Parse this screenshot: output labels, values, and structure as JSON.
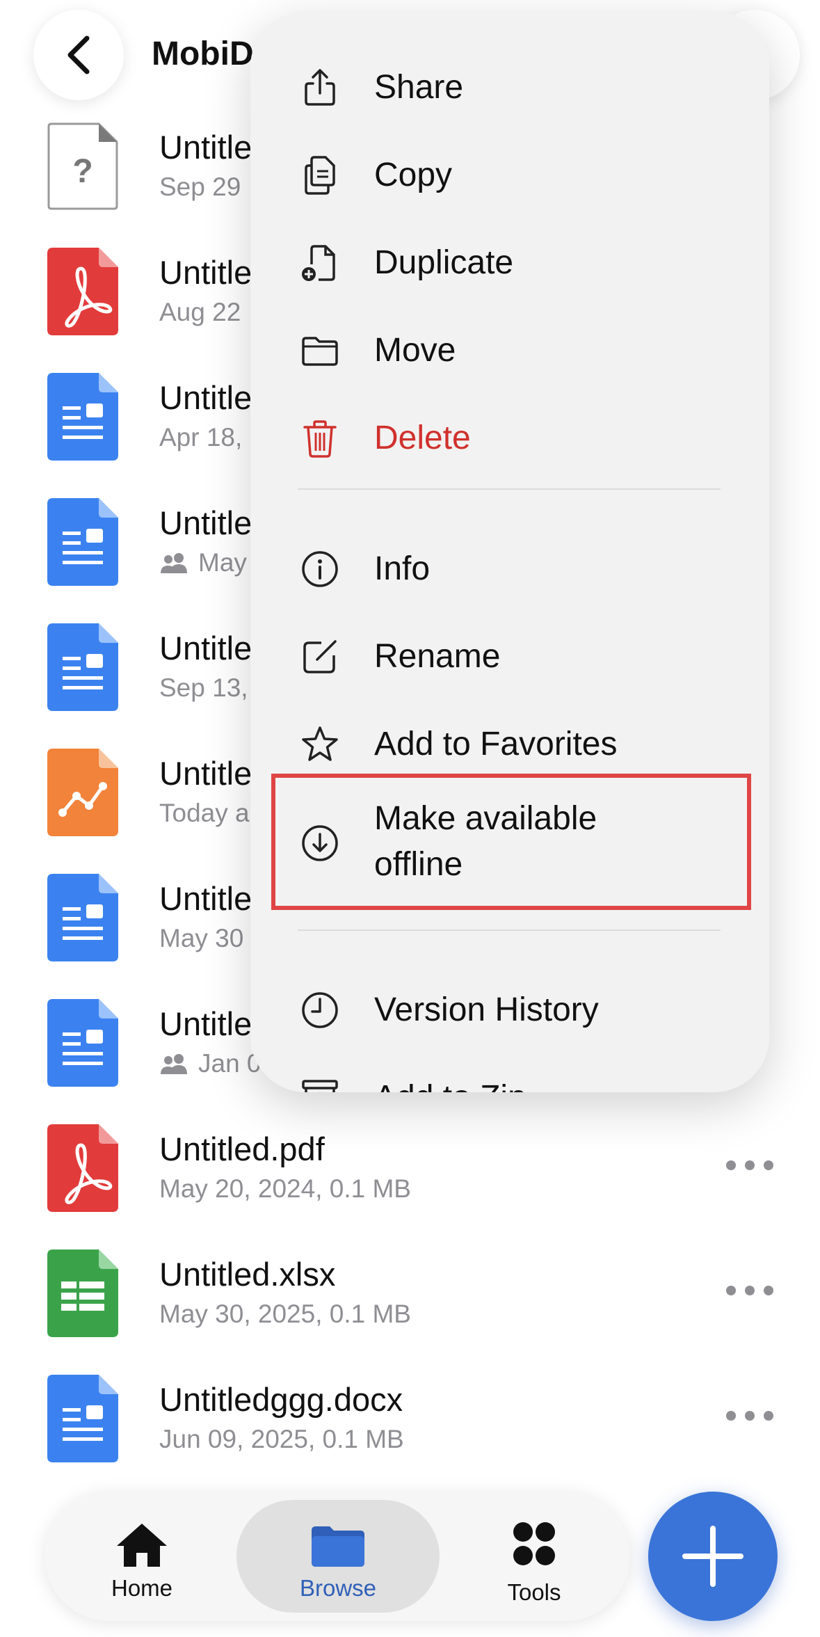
{
  "header": {
    "title": "MobiD"
  },
  "files": [
    {
      "name": "Untitle",
      "meta": "Sep 29",
      "type": "unknown",
      "shared": false
    },
    {
      "name": "Untitle",
      "meta": "Aug 22",
      "type": "pdf",
      "shared": false
    },
    {
      "name": "Untitle",
      "meta": "Apr 18,",
      "type": "doc",
      "shared": false
    },
    {
      "name": "Untitle",
      "meta": "May",
      "type": "doc",
      "shared": true
    },
    {
      "name": "Untitle",
      "meta": "Sep 13,",
      "type": "doc",
      "shared": false
    },
    {
      "name": "Untitle",
      "meta": "Today a",
      "type": "chart",
      "shared": false
    },
    {
      "name": "Untitle",
      "meta": "May 30",
      "type": "doc",
      "shared": false
    },
    {
      "name": "Untitle",
      "meta": "Jan 0",
      "type": "doc",
      "shared": true
    },
    {
      "name": "Untitled.pdf",
      "meta": "May 20, 2024, 0.1 MB",
      "type": "pdf",
      "shared": false
    },
    {
      "name": "Untitled.xlsx",
      "meta": "May 30, 2025, 0.1 MB",
      "type": "xlsx",
      "shared": false
    },
    {
      "name": "Untitledggg.docx",
      "meta": "Jun 09, 2025, 0.1 MB",
      "type": "doc",
      "shared": false
    }
  ],
  "menu": {
    "items": [
      {
        "label": "Share",
        "icon": "share-icon"
      },
      {
        "label": "Copy",
        "icon": "copy-icon"
      },
      {
        "label": "Duplicate",
        "icon": "duplicate-icon"
      },
      {
        "label": "Move",
        "icon": "folder-icon"
      },
      {
        "label": "Delete",
        "icon": "trash-icon",
        "destructive": true
      },
      {
        "label": "Info",
        "icon": "info-icon"
      },
      {
        "label": "Rename",
        "icon": "rename-icon"
      },
      {
        "label": "Add to Favorites",
        "icon": "star-icon"
      },
      {
        "label": "Make available offline",
        "label_line1": "Make available",
        "label_line2": "offline",
        "icon": "download-icon",
        "highlighted": true
      },
      {
        "label": "Version History",
        "icon": "clock-icon"
      },
      {
        "label": "Add to Zip",
        "icon": "zip-icon"
      }
    ]
  },
  "tabbar": {
    "tabs": [
      {
        "label": "Home",
        "icon": "house-icon"
      },
      {
        "label": "Browse",
        "icon": "folder-icon",
        "selected": true
      },
      {
        "label": "Tools",
        "icon": "grid-dots-icon"
      }
    ]
  },
  "colors": {
    "accent": "#3a74d8",
    "destructive": "#d0312d",
    "highlight_border": "#e04545",
    "pdf": "#e23b3b",
    "doc": "#3b82f0",
    "xlsx": "#3aa34a",
    "chart": "#f2833a"
  }
}
